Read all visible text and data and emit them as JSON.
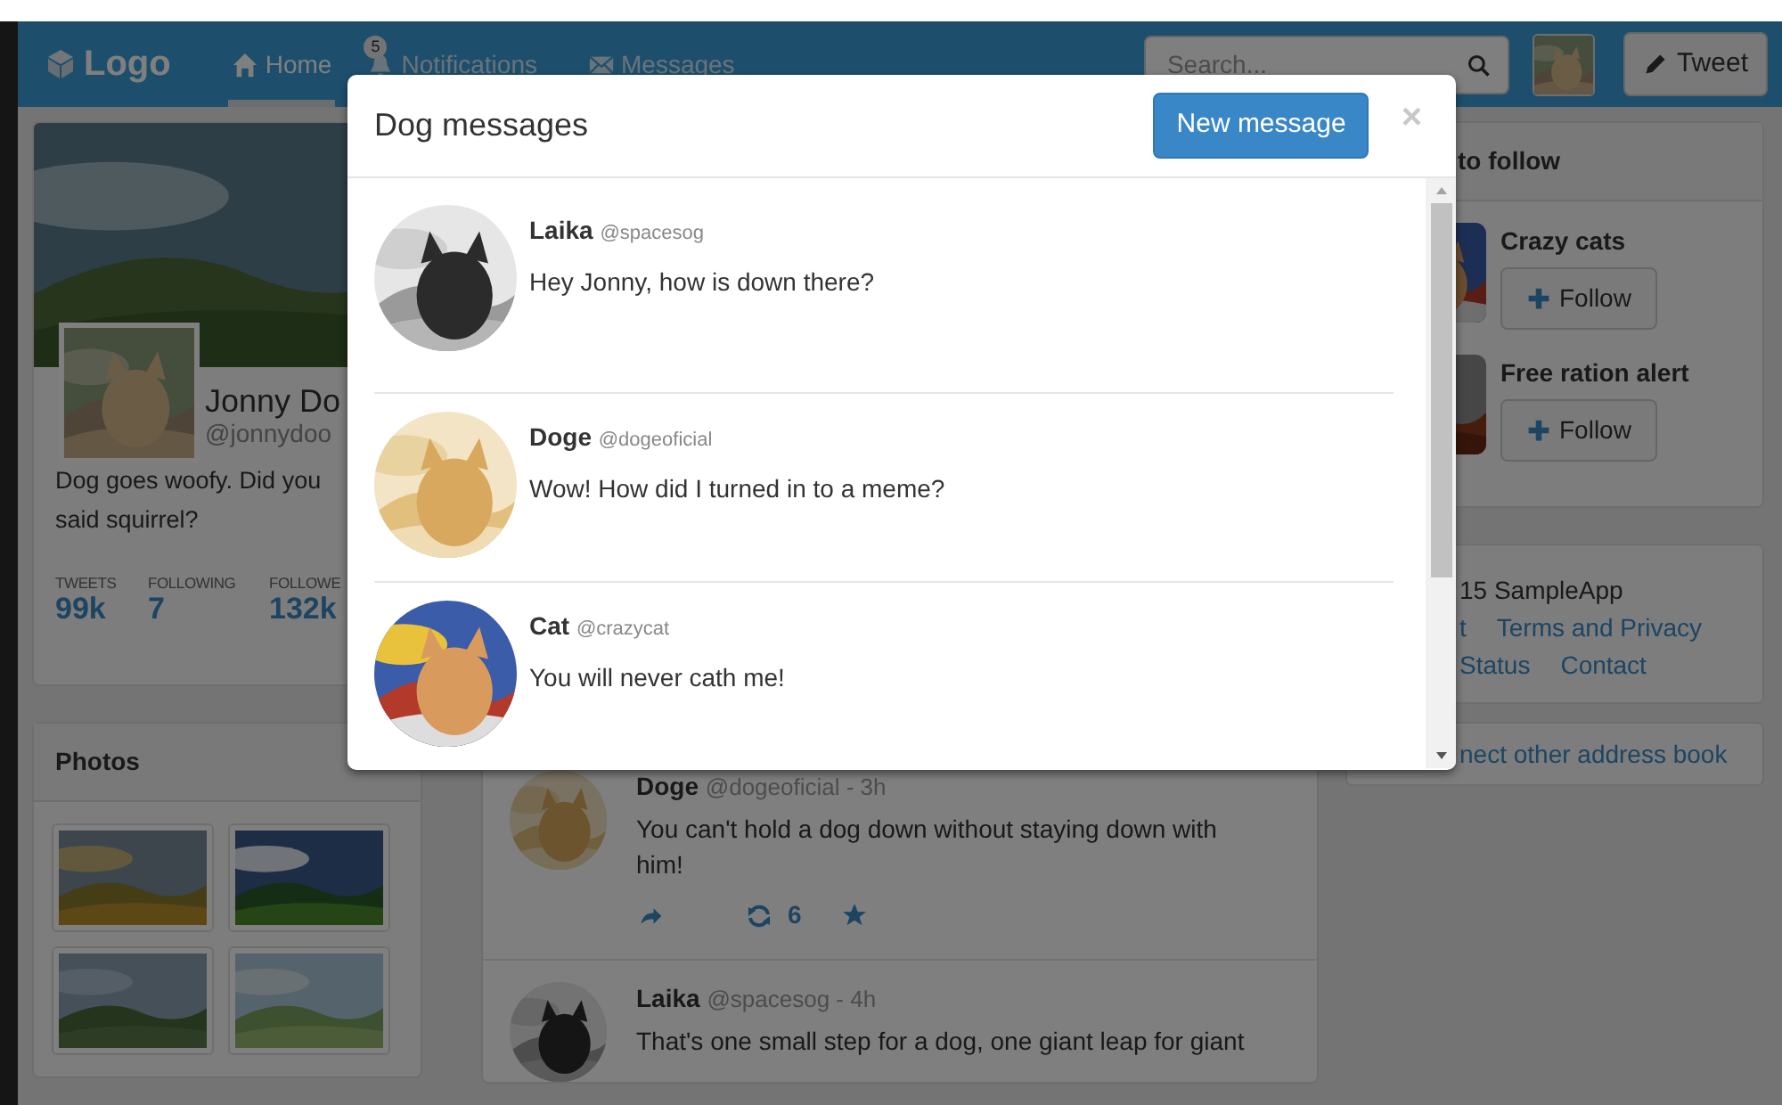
{
  "navbar": {
    "logo": "Logo",
    "links": [
      {
        "label": "Home",
        "selected": true
      },
      {
        "label": "Notifications",
        "badge": "5",
        "selected": false
      },
      {
        "label": "Messages",
        "selected": false
      }
    ],
    "search": {
      "placeholder": "Search..."
    },
    "tweet_button": "Tweet"
  },
  "profile": {
    "name": "Jonny Do",
    "handle": "@jonnydoo",
    "bio_lines": [
      "Dog goes woofy. Did you",
      "said squirrel?"
    ],
    "stats": [
      {
        "label": "TWEETS",
        "value": "99k"
      },
      {
        "label": "FOLLOWING",
        "value": "7"
      },
      {
        "label": "FOLLOWE",
        "value": "132k"
      }
    ]
  },
  "photos": {
    "title": "Photos"
  },
  "feed": [
    {
      "name": "Doge",
      "handle": "@dogeoficial - 3h",
      "text": "You can't hold a dog down without staying down with him!",
      "retweets": "6"
    },
    {
      "name": "Laika",
      "handle": "@spacesog - 4h",
      "text": "That's one small step for a dog, one giant leap for giant"
    }
  ],
  "who_to_follow": {
    "title": "to follow",
    "items": [
      {
        "name": "Crazy cats",
        "button": "Follow"
      },
      {
        "name": "Free ration alert",
        "button": "Follow"
      }
    ]
  },
  "footer": {
    "copyright": "15 SampleApp",
    "links": [
      "t",
      "Terms and Privacy",
      "Status",
      "Contact"
    ]
  },
  "connect_link": "nect other address book",
  "modal": {
    "title": "Dog messages",
    "new_button": "New message",
    "close": "×",
    "messages": [
      {
        "name": "Laika",
        "handle": "@spacesog",
        "text": "Hey Jonny, how is down there?"
      },
      {
        "name": "Doge",
        "handle": "@dogeoficial",
        "text": "Wow! How did I turned in to a meme?"
      },
      {
        "name": "Cat",
        "handle": "@crazycat",
        "text": "You will never cath me!"
      }
    ]
  }
}
